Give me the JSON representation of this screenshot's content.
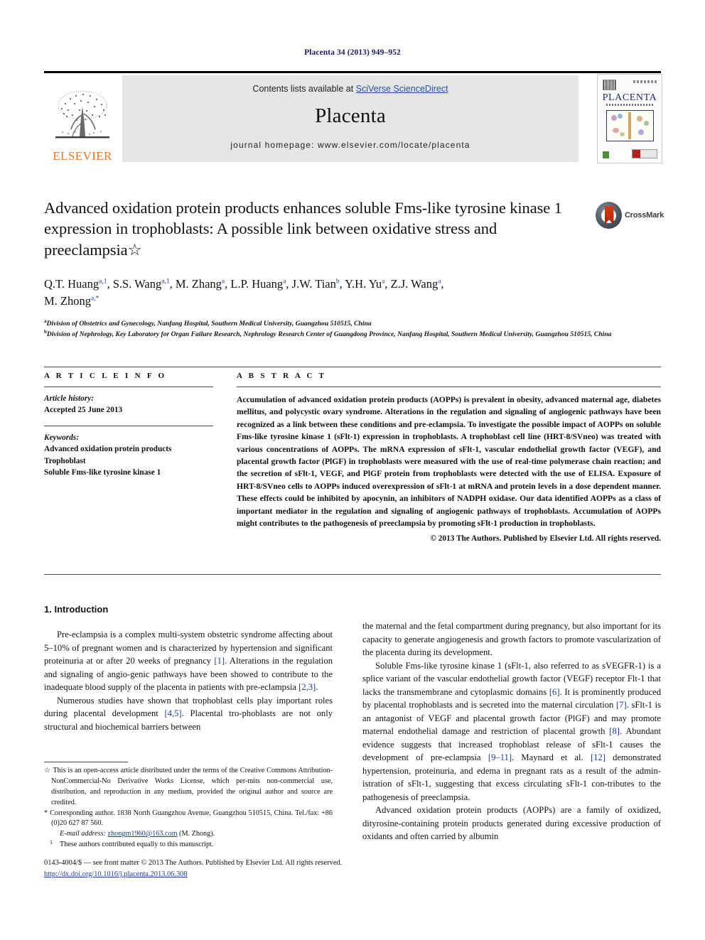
{
  "running_head": "Placenta 34 (2013) 949–952",
  "masthead": {
    "publisher_name": "ELSEVIER",
    "contents_prefix": "Contents lists available at ",
    "contents_link": "SciVerse ScienceDirect",
    "journal_title": "Placenta",
    "homepage_label": "journal homepage: www.elsevier.com/locate/placenta",
    "cover_title": "PLACENTA",
    "link_color": "#2152a0",
    "band_color": "#e6e6e6",
    "elsevier_orange": "#E87722"
  },
  "crossmark": {
    "label": "CrossMark"
  },
  "article": {
    "title": "Advanced oxidation protein products enhances soluble Fms-like tyrosine kinase 1 expression in trophoblasts: A possible link between oxidative stress and preeclampsia☆",
    "authors_line1": "Q.T. Huang",
    "authors": "Q.T. Huang a,1, S.S. Wang a,1, M. Zhang a, L.P. Huang a, J.W. Tian b, Y.H. Yu a, Z.J. Wang a, M. Zhong a,*",
    "affiliation_a": "Division of Obstetrics and Gynecology, Nanfang Hospital, Southern Medical University, Guangzhou 510515, China",
    "affiliation_b": "Division of Nephrology, Key Laboratory for Organ Failure Research, Nephrology Research Center of Guangdong Province, Nanfang Hospital, Southern Medical University, Guangzhou 510515, China"
  },
  "article_info": {
    "heading": "A R T I C L E   I N F O",
    "history_label": "Article history:",
    "history_value": "Accepted 25 June 2013",
    "keywords_label": "Keywords:",
    "keywords": [
      "Advanced oxidation protein products",
      "Trophoblast",
      "Soluble Fms-like tyrosine kinase 1"
    ]
  },
  "abstract": {
    "heading": "A B S T R A C T",
    "text": "Accumulation of advanced oxidation protein products (AOPPs) is prevalent in obesity, advanced maternal age, diabetes mellitus, and polycystic ovary syndrome. Alterations in the regulation and signaling of angiogenic pathways have been recognized as a link between these conditions and pre-eclampsia. To investigate the possible impact of AOPPs on soluble Fms-like tyrosine kinase 1 (sFlt-1) expression in trophoblasts. A trophoblast cell line (HRT-8/SVneo) was treated with various concentrations of AOPPs. The mRNA expression of sFlt-1, vascular endothelial growth factor (VEGF), and placental growth factor (PlGF) in trophoblasts were measured with the use of real-time polymerase chain reaction; and the secretion of sFlt-1, VEGF, and PlGF protein from trophoblasts were detected with the use of ELISA. Exposure of HRT-8/SVneo cells to AOPPs induced overexpression of sFlt-1 at mRNA and protein levels in a dose dependent manner. These effects could be inhibited by apocynin, an inhibitors of NADPH oxidase. Our data identified AOPPs as a class of important mediator in the regulation and signaling of angiogenic pathways of trophoblasts. Accumulation of AOPPs might contributes to the pathogenesis of preeclampsia by promoting sFlt-1 production in trophoblasts.",
    "copyright": "© 2013 The Authors. Published by Elsevier Ltd. All rights reserved."
  },
  "body": {
    "section_heading": "1.  Introduction",
    "left_p1_a": "Pre-eclampsia is a complex multi-system obstetric syndrome affecting about 5–10% of pregnant women and is characterized by hypertension and significant proteinuria at or after 20 weeks of pregnancy ",
    "left_p1_ref1": "[1]",
    "left_p1_b": ". Alterations in the regulation and signaling of angio-genic pathways have been showed to contribute to the inadequate blood supply of the placenta in patients with pre-eclampsia ",
    "left_p1_ref2": "[2,3]",
    "left_p1_c": ".",
    "left_p2_a": "Numerous studies have shown that trophoblast cells play important roles during placental development ",
    "left_p2_ref1": "[4,5]",
    "left_p2_b": ". Placental tro-phoblasts are not only structural and biochemical barriers between",
    "right_p0": "the maternal and the fetal compartment during pregnancy, but also important for its capacity to generate angiogenesis and growth factors to promote vascularization of the placenta during its development.",
    "right_p1_a": "Soluble Fms-like tyrosine kinase 1 (sFlt-1, also referred to as sVEGFR-1) is a splice variant of the vascular endothelial growth factor (VEGF) receptor Flt-1 that lacks the transmembrane and cytoplasmic domains ",
    "right_p1_ref1": "[6]",
    "right_p1_b": ". It is prominently produced by placental trophoblasts and is secreted into the maternal circulation ",
    "right_p1_ref2": "[7]",
    "right_p1_c": ". sFlt-1 is an antagonist of VEGF and placental growth factor (PlGF) and may promote maternal endothelial damage and restriction of placental growth ",
    "right_p1_ref3": "[8]",
    "right_p1_d": ". Abundant evidence suggests that increased trophoblast release of sFlt-1 causes the development of pre-eclampsia ",
    "right_p1_ref4": "[9–11]",
    "right_p1_e": ". Maynard et al. ",
    "right_p1_ref5": "[12]",
    "right_p1_f": " demonstrated hypertension, proteinuria, and edema in pregnant rats as a result of the admin-istration of sFlt-1, suggesting that excess circulating sFlt-1 con-tributes to the pathogenesis of preeclampsia.",
    "right_p2": "Advanced oxidation protein products (AOPPs) are a family of oxidized, dityrosine-containing protein products generated during excessive production of oxidants and often carried by albumin"
  },
  "footnotes": {
    "star_marker": "☆",
    "star_text": "This is an open-access article distributed under the terms of the Creative Commons Attribution-NonCommercial-No Derivative Works License, which per-mits non-commercial use, distribution, and reproduction in any medium, provided the original author and source are credited.",
    "corr_marker": "*",
    "corr_text": "Corresponding author. 1838 North Guangzhou Avenue, Guangzhou 510515, China. Tel./fax: +86 (0)20 627 87 560.",
    "email_label": "E-mail address:",
    "email_value": "zhongm1960@163.com",
    "email_suffix": " (M. Zhong).",
    "equal_marker": "1",
    "equal_text": "These authors contributed equally to this manuscript."
  },
  "bottom": {
    "issn_line": "0143-4004/$ — see front matter © 2013 The Authors. Published by Elsevier Ltd. All rights reserved.",
    "doi": "http://dx.doi.org/10.1016/j.placenta.2013.06.308"
  }
}
